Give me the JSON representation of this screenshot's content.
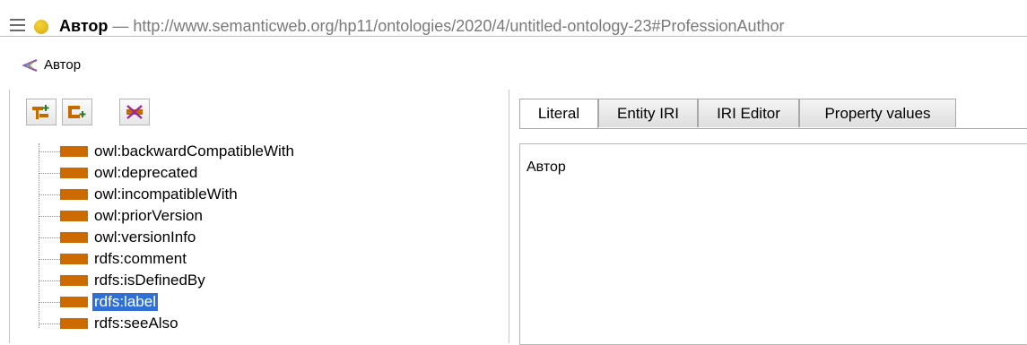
{
  "window": {
    "entity_name": "Автор",
    "separator": " — ",
    "entity_iri": "http://www.semanticweb.org/hp11/ontologies/2020/4/untitled-ontology-23#ProfessionAuthor",
    "status_color": "#e8bd1c"
  },
  "breadcrumb": {
    "label": "Автор",
    "icon": "class-icon"
  },
  "toolbar": {
    "buttons": [
      {
        "icon": "add-subproperty-icon"
      },
      {
        "icon": "add-sibling-property-icon"
      },
      {
        "icon": "delete-property-icon"
      }
    ]
  },
  "tree": {
    "items": [
      {
        "label": "owl:backwardCompatibleWith"
      },
      {
        "label": "owl:deprecated"
      },
      {
        "label": "owl:incompatibleWith"
      },
      {
        "label": "owl:priorVersion"
      },
      {
        "label": "owl:versionInfo"
      },
      {
        "label": "rdfs:comment"
      },
      {
        "label": "rdfs:isDefinedBy"
      },
      {
        "label": "rdfs:label",
        "selected": true
      },
      {
        "label": "rdfs:seeAlso"
      }
    ],
    "property_color": "#cc6a00",
    "selection_color": "#2f6fd6"
  },
  "tabs": [
    {
      "label": "Literal",
      "active": true
    },
    {
      "label": "Entity IRI"
    },
    {
      "label": "IRI Editor"
    },
    {
      "label": "Property values"
    }
  ],
  "editor": {
    "value": "Автор"
  }
}
